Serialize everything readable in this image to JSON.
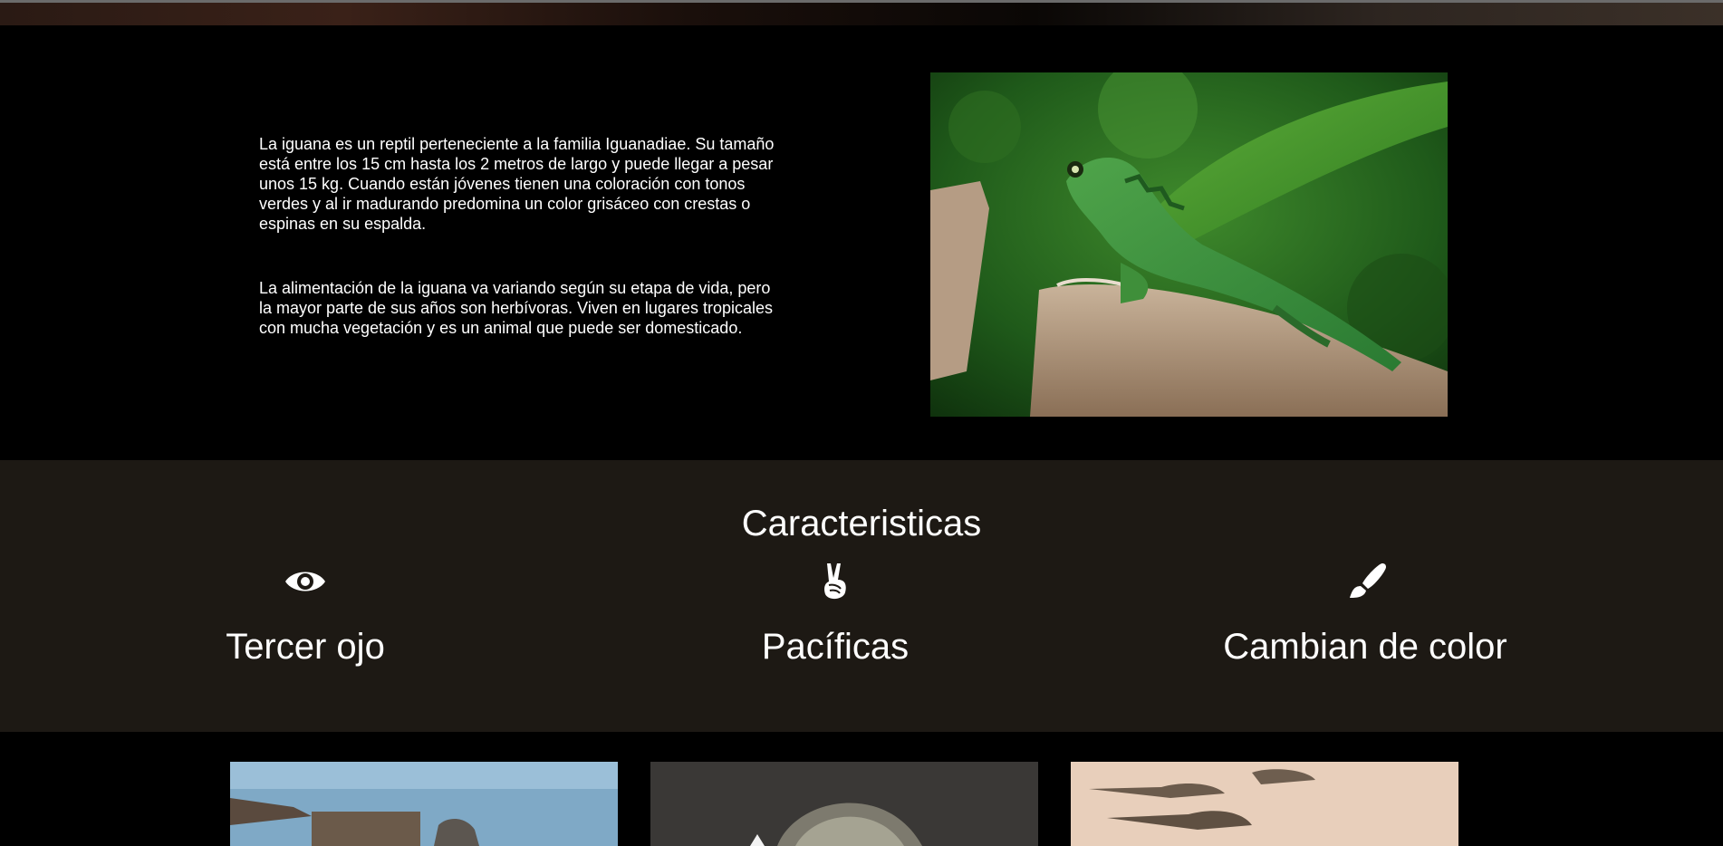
{
  "intro": {
    "paragraphs": [
      "La iguana es un reptil perteneciente a la familia Iguanadiae. Su tamaño está entre los 15 cm hasta los 2 metros de largo y puede llegar a pesar unos 15 kg. Cuando están jóvenes tienen una coloración con tonos verdes y al ir madurando predomina un color grisáceo con crestas o espinas en su espalda.",
      "La alimentación de la iguana va variando según su etapa de vida, pero la mayor parte de sus años son herbívoras. Viven en lugares tropicales con mucha vegetación y es un animal que puede ser domesticado."
    ],
    "image_icon": "iguana-photo"
  },
  "features": {
    "title": "Caracteristicas",
    "items": [
      {
        "label": "Tercer ojo",
        "icon": "eye-icon"
      },
      {
        "label": "Pacíficas",
        "icon": "peace-hand-icon"
      },
      {
        "label": "Cambian de color",
        "icon": "paint-brush-icon"
      }
    ]
  },
  "gallery": {
    "images": [
      "iguana-on-rock-photo",
      "iguana-closeup-photo",
      "iguanas-on-sand-photo"
    ]
  },
  "colors": {
    "background": "#000000",
    "features_bg": "#1d1914",
    "text": "#ffffff"
  }
}
